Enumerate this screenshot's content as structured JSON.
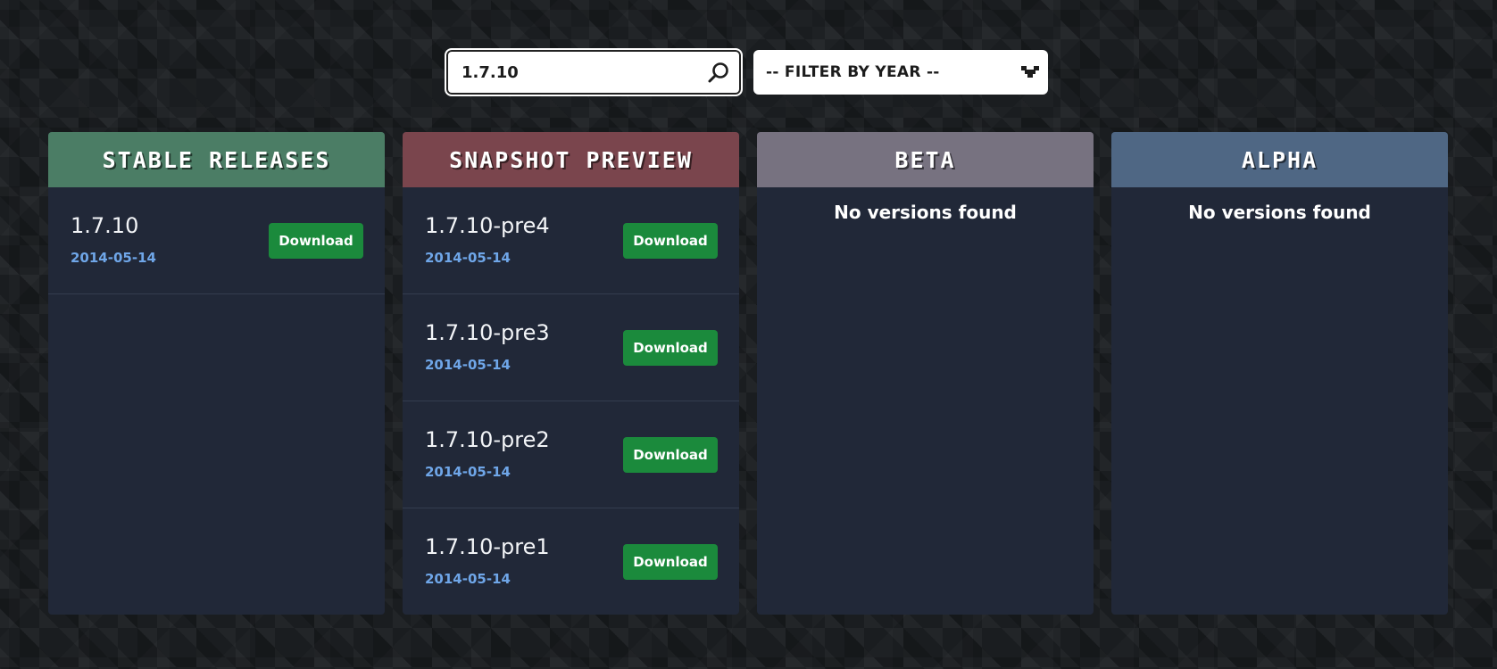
{
  "search": {
    "value": "1.7.10"
  },
  "filter": {
    "label": "-- FILTER BY YEAR --"
  },
  "colors": {
    "stable": "#4b7d65",
    "snapshot": "#7a454d",
    "beta": "#777280",
    "alpha": "#4f6784",
    "download_button": "#1b8a3c",
    "date": "#6fa6e8",
    "panel": "#212838"
  },
  "columns": [
    {
      "id": "stable",
      "title": "STABLE RELEASES",
      "versions": [
        {
          "name": "1.7.10",
          "date": "2014-05-14",
          "button": "Download"
        }
      ],
      "empty_text": ""
    },
    {
      "id": "snapshot",
      "title": "SNAPSHOT PREVIEW",
      "versions": [
        {
          "name": "1.7.10-pre4",
          "date": "2014-05-14",
          "button": "Download"
        },
        {
          "name": "1.7.10-pre3",
          "date": "2014-05-14",
          "button": "Download"
        },
        {
          "name": "1.7.10-pre2",
          "date": "2014-05-14",
          "button": "Download"
        },
        {
          "name": "1.7.10-pre1",
          "date": "2014-05-14",
          "button": "Download"
        }
      ],
      "empty_text": ""
    },
    {
      "id": "beta",
      "title": "BETA",
      "versions": [],
      "empty_text": "No versions found"
    },
    {
      "id": "alpha",
      "title": "ALPHA",
      "versions": [],
      "empty_text": "No versions found"
    }
  ]
}
